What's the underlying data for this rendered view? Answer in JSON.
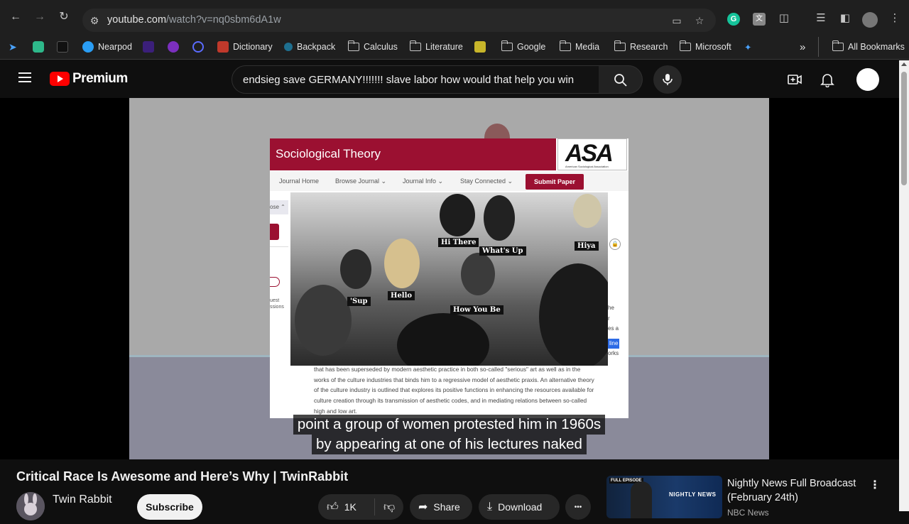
{
  "browser": {
    "url_host": "youtube.com",
    "url_path": "/watch?v=nq0sbm6dA1w",
    "bookmarks": [
      {
        "label": "Nearpod",
        "icon": "nearpod-icon"
      },
      {
        "label": "Dictionary",
        "icon": "dictionary-icon"
      },
      {
        "label": "Backpack",
        "icon": "backpack-icon"
      },
      {
        "label": "Calculus",
        "icon": "folder-icon"
      },
      {
        "label": "Literature",
        "icon": "folder-icon"
      },
      {
        "label": "Google",
        "icon": "folder-icon"
      },
      {
        "label": "Media",
        "icon": "folder-icon"
      },
      {
        "label": "Research",
        "icon": "folder-icon"
      },
      {
        "label": "Microsoft",
        "icon": "folder-icon"
      }
    ],
    "all_bookmarks": "All Bookmarks",
    "overflow": "»"
  },
  "youtube": {
    "logo_text": "Premium",
    "search_query": "endsieg save GERMANY!!!!!!! slave labor how would that help you win"
  },
  "video": {
    "journal_title": "Sociological Theory",
    "logo_text": "ASA",
    "logo_sub": "American Sociological Association",
    "nav": [
      "Journal Home",
      "Browse Journal",
      "Journal Info",
      "Stay Connected"
    ],
    "submit_label": "Submit Paper",
    "side_label": "ose",
    "side_text_1": "uest",
    "side_text_2": "ssions",
    "right_fragments": [
      "he",
      "r",
      "es a",
      "line",
      "orks"
    ],
    "body_lines": [
      "that has been superseded by modern aesthetic practice in both so-called \"serious\" art as well as in the",
      "works of the culture industries that binds him to a regressive model of aesthetic praxis. An alternative theory",
      "of the culture industry is outlined that explores its positive functions in enhancing the resources available for",
      "culture creation through its transmission of aesthetic codes, and in mediating relations between so-called",
      "high and low art."
    ],
    "speech_labels": [
      "Hi There",
      "What's Up",
      "Hiya",
      "'Sup",
      "Hello",
      "How You Be"
    ],
    "captions": [
      "point a group of women protested him in 1960s",
      "by appearing at one of his lectures naked"
    ]
  },
  "below": {
    "title": "Critical Race Is Awesome and Here’s Why | TwinRabbit",
    "channel": "Twin Rabbit",
    "subscribe": "Subscribe",
    "likes": "1K",
    "share": "Share",
    "download": "Download",
    "more": "•••"
  },
  "recommendation": {
    "badge": "FULL EPISODE",
    "thumb_text": "NIGHTLY NEWS",
    "title": "Nightly News Full Broadcast (February 24th)",
    "channel": "NBC News"
  },
  "colors": {
    "youtube_red": "#ff0000",
    "asa_maroon": "#9b1031"
  }
}
